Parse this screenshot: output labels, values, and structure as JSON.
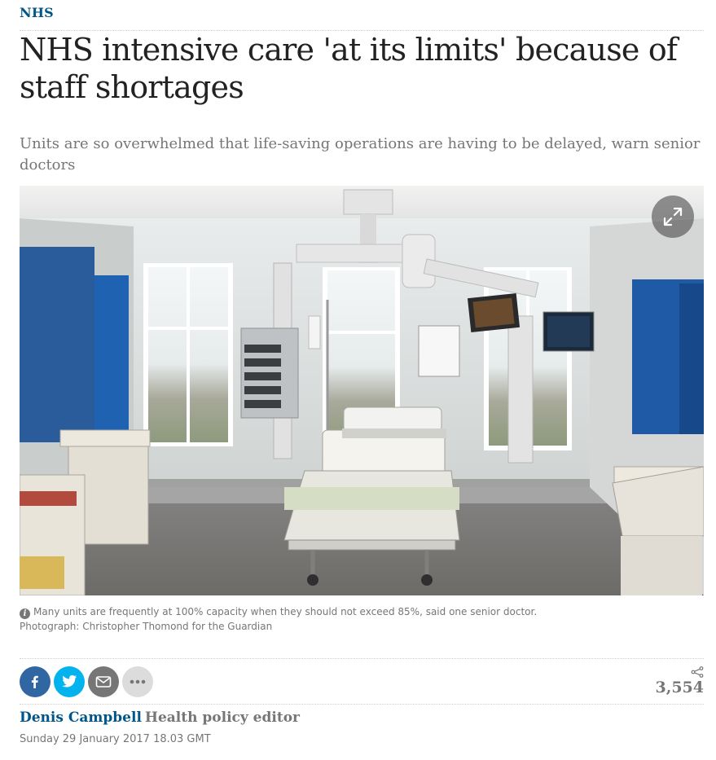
{
  "section": {
    "label": "NHS"
  },
  "headline": "NHS intensive care 'at its limits' because of staff shortages",
  "standfirst": "Units are so overwhelmed that life-saving operations are having to be delayed, warn senior doctors",
  "media": {
    "alt": "Intensive care hospital room with bed, monitors and equipment",
    "expand_icon": "expand-icon"
  },
  "caption": {
    "info_icon": "i",
    "text": "Many units are frequently at 100% capacity when they should not exceed 85%, said one senior doctor.",
    "credit": "Photograph: Christopher Thomond for the Guardian"
  },
  "share": {
    "buttons": [
      {
        "icon": "facebook-icon",
        "color": "#3067a3"
      },
      {
        "icon": "twitter-icon",
        "color": "#03b3ee"
      },
      {
        "icon": "email-icon",
        "color": "#767676"
      },
      {
        "icon": "more-icon",
        "color": "#dcdcdc"
      }
    ],
    "count": "3,554"
  },
  "byline": {
    "name": "Denis Campbell",
    "role": "Health policy editor"
  },
  "dateline": "Sunday 29 January 2017 18.03 GMT",
  "colors": {
    "link": "#005689",
    "muted": "#767676",
    "headline": "#222222"
  }
}
